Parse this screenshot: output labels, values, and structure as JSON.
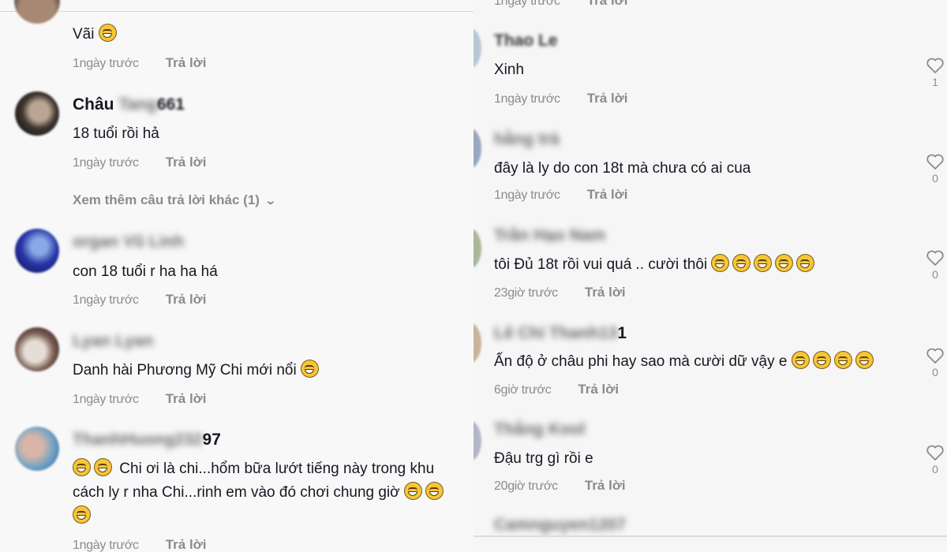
{
  "left_panel": {
    "reply_label": "Trả lời",
    "view_more_replies": "Xem thêm câu trả lời khác (1)",
    "comments": [
      {
        "username": "",
        "text": "Vãi",
        "emoji_count": 1,
        "time": "1ngày trước"
      },
      {
        "username_visible": "Châu",
        "username_blurred": "Tang",
        "username_suffix": "661",
        "text": "18 tuổi rồi hả",
        "time": "1ngày trước"
      },
      {
        "username_blurred": "organ Vũ Linh",
        "text": "con 18 tuổi r ha ha há",
        "time": "1ngày trước"
      },
      {
        "username_blurred": "Lyan Lyan",
        "text": "Danh hài Phương Mỹ Chi mới nổi",
        "emoji_count": 1,
        "time": "1ngày trước"
      },
      {
        "username_blurred": "ThanhHuong232",
        "username_suffix": "97",
        "line1": "Chi ơi là chi...hổm bữa lướt tiếng này trong khu",
        "line2": "cách ly r nha Chi...rinh em vào đó chơi chung giờ",
        "time": "1ngày trước"
      }
    ]
  },
  "right_panel": {
    "reply_label": "Trả lời",
    "top_partial_time": "1ngày trước",
    "comments": [
      {
        "username_blurred": "Thao Le",
        "text": "Xinh",
        "time": "1ngày trước",
        "likes": "1"
      },
      {
        "username_blurred": "hằng trà",
        "text": "đây là ly do con 18t mà chưa có ai cua",
        "time": "1ngày trước",
        "likes": "0"
      },
      {
        "username_blurred": "Trần Hạo Nam",
        "text": "tôi Đủ 18t rồi vui quá .. cười thôi",
        "emoji_count": 5,
        "time": "23giờ trước",
        "likes": "0"
      },
      {
        "username_blurred": "Lê Chi Thanh13",
        "username_suffix": "1",
        "text": "Ấn độ ở châu phi hay sao mà cười dữ vậy e",
        "emoji_count": 4,
        "time": "6giờ trước",
        "likes": "0"
      },
      {
        "username_blurred": "Thắng Kool",
        "text": "Đậu trg gì rồi e",
        "time": "20giờ trước",
        "likes": "0"
      },
      {
        "username_blurred": "Camnguyen1207",
        "text": ""
      }
    ]
  },
  "colors": {
    "background": "#f8f8f8",
    "secondary_text": "#8a8b91",
    "primary_text": "#161823",
    "emoji": "#f5c63a"
  },
  "icons": {
    "like": "heart-outline-icon",
    "expand": "chevron-down-icon",
    "emoji": "grinning-squinting-face-icon"
  }
}
